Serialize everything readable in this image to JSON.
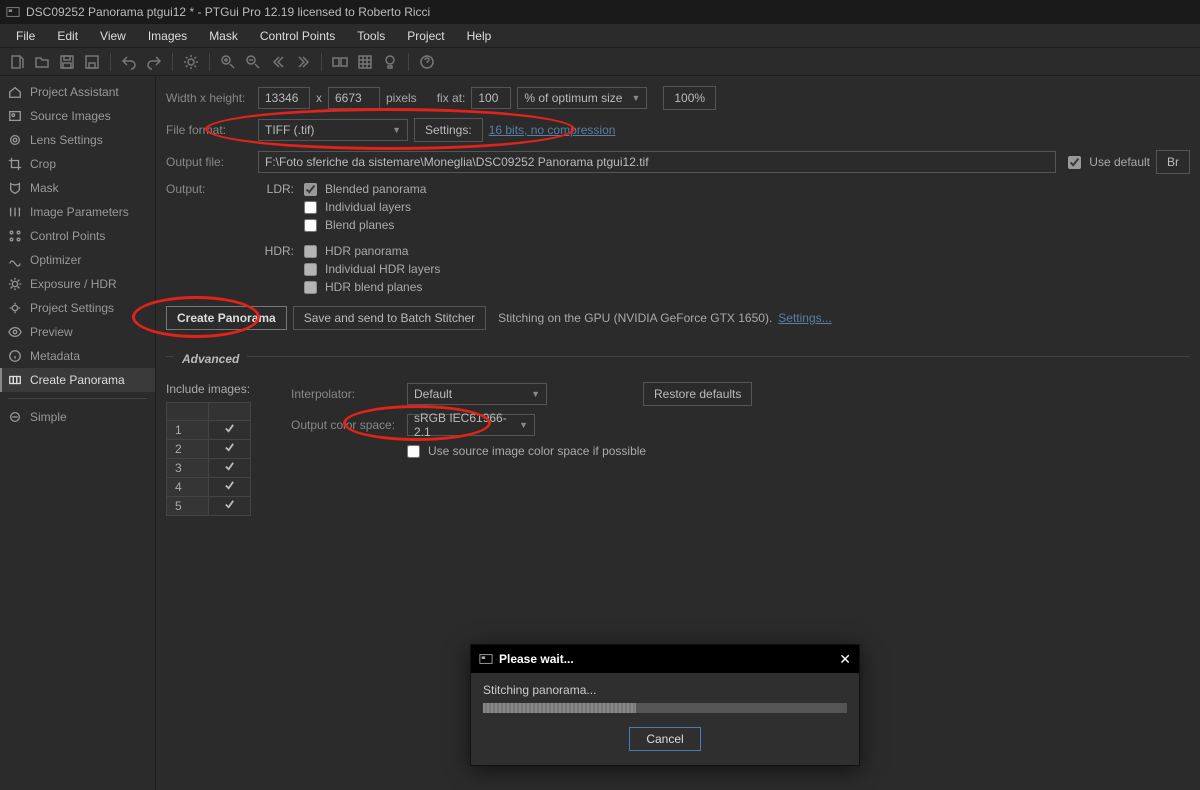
{
  "window": {
    "title": "DSC09252 Panorama ptgui12 * - PTGui Pro 12.19 licensed to Roberto Ricci"
  },
  "menu": {
    "file": "File",
    "edit": "Edit",
    "view": "View",
    "images": "Images",
    "mask": "Mask",
    "cp": "Control Points",
    "tools": "Tools",
    "project": "Project",
    "help": "Help"
  },
  "sidebar": {
    "items": [
      "Project Assistant",
      "Source Images",
      "Lens Settings",
      "Crop",
      "Mask",
      "Image Parameters",
      "Control Points",
      "Optimizer",
      "Exposure / HDR",
      "Project Settings",
      "Preview",
      "Metadata",
      "Create Panorama"
    ],
    "simple": "Simple"
  },
  "form": {
    "wh_label": "Width x height:",
    "width": "13346",
    "x": "x",
    "height": "6673",
    "pixels": "pixels",
    "fixat": "fix at:",
    "fix": "100",
    "ofopt": "% of optimum size",
    "pct100": "100%",
    "ff_label": "File format:",
    "ff": "TIFF (.tif)",
    "settings": "Settings:",
    "ff_desc": "16 bits, no compression",
    "out_label": "Output file:",
    "out": "F:\\Foto sferiche da sistemare\\Moneglia\\DSC09252 Panorama ptgui12.tif",
    "use_def": "Use default",
    "browse": "Br",
    "output_label": "Output:",
    "ldr": "LDR:",
    "blended": "Blended panorama",
    "indiv": "Individual layers",
    "blendplanes": "Blend planes",
    "hdr": "HDR:",
    "hdrpan": "HDR panorama",
    "indivhdr": "Individual HDR layers",
    "hdrblend": "HDR blend planes",
    "create": "Create Panorama",
    "batch": "Save and send to Batch Stitcher",
    "stitch_info": "Stitching on the GPU (NVIDIA GeForce GTX 1650).",
    "stitch_link": "Settings..."
  },
  "adv": {
    "title": "Advanced",
    "include": "Include images:",
    "interp": "Interpolator:",
    "interp_v": "Default",
    "restore": "Restore defaults",
    "ocs": "Output color space:",
    "ocs_v": "sRGB IEC61966-2.1",
    "use_src": "Use source image color space if possible",
    "rows": [
      "1",
      "2",
      "3",
      "4",
      "5"
    ]
  },
  "dlg": {
    "title": "Please wait...",
    "status": "Stitching panorama...",
    "cancel": "Cancel"
  }
}
